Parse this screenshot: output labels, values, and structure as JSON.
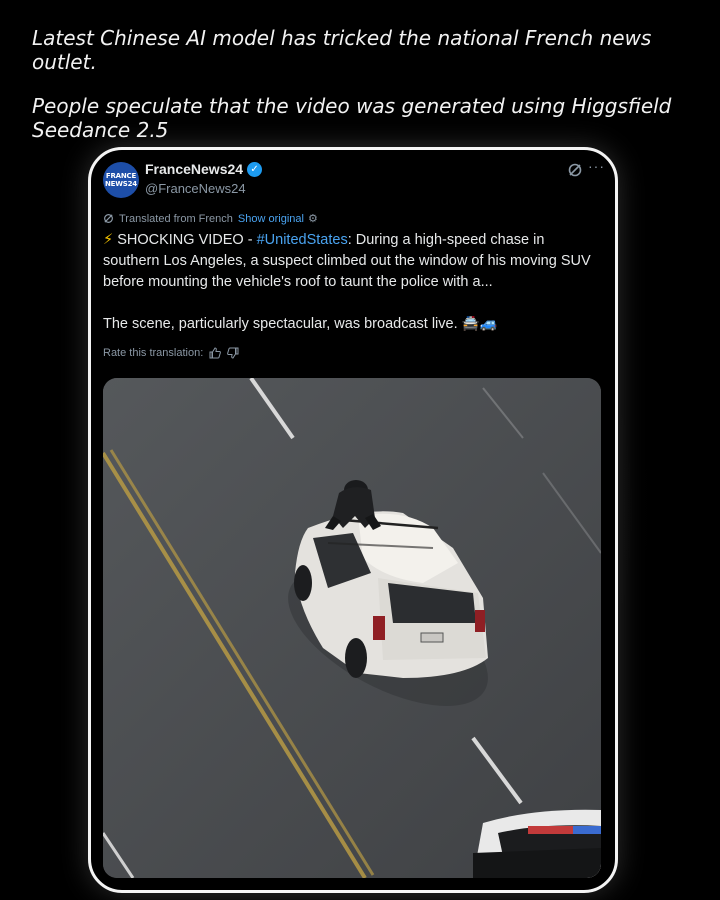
{
  "caption": {
    "line1": "Latest Chinese AI model has tricked the national French news outlet.",
    "line2": "People speculate that the video was generated using Higgsfield Seedance 2.5"
  },
  "post": {
    "avatar_top": "FRANCE",
    "avatar_bottom": "NEWS24",
    "author_name": "FranceNews24",
    "verified_mark": "✓",
    "handle": "@FranceNews24",
    "more_label": "···",
    "translated_label": "Translated from French",
    "show_original": "Show original",
    "settings_glyph": "⚙",
    "text": {
      "bolt": "⚡",
      "lead": " SHOCKING VIDEO - ",
      "hashtag": "#UnitedStates",
      "rest": ": During a high-speed chase in southern Los Angeles, a suspect climbed out the window of his moving SUV before mounting the vehicle's roof to taunt the police with a...",
      "second": "The scene, particularly spectacular, was broadcast live. 🚔🚙"
    },
    "rate_label": "Rate this translation:",
    "media": {
      "description_icon": "video-frame",
      "road_color": "#4b4d50",
      "car_color": "#e8e6e2"
    }
  },
  "colors": {
    "accent": "#1d9bf0",
    "link": "#4aa3f0",
    "muted": "#8b98a5",
    "card_border": "#f4f4f4"
  }
}
